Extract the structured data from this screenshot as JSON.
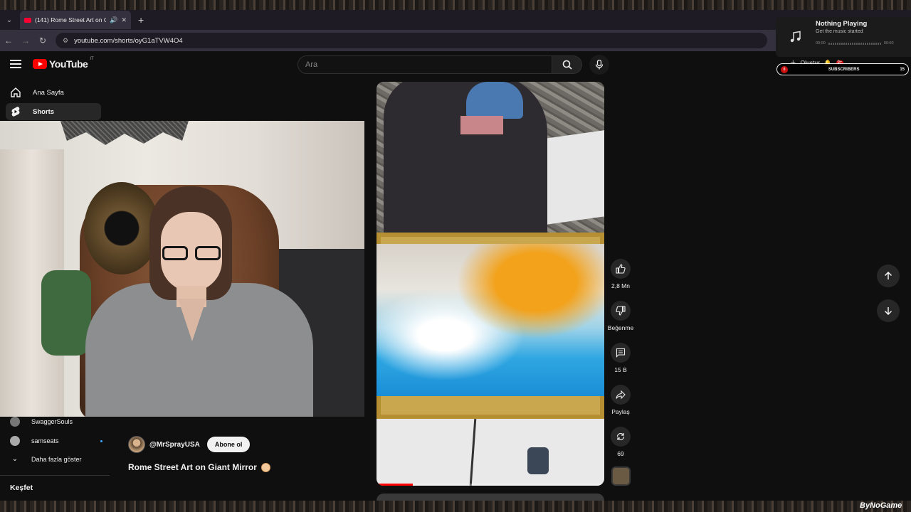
{
  "browser": {
    "tab_title": "(141) Rome Street Art on G",
    "url": "youtube.com/shorts/oyG1aTVW4O4",
    "new_tab": "+"
  },
  "youtube": {
    "logo": "YouTube",
    "region": "IT",
    "search_placeholder": "Ara",
    "create_label": "Oluştur",
    "notification_badge": "9+",
    "sidebar": {
      "items": [
        {
          "label": "Ana Sayfa",
          "icon": "home-icon"
        },
        {
          "label": "Shorts",
          "icon": "shorts-icon",
          "active": true
        }
      ],
      "subscriptions": [
        {
          "label": "SwaggerSouls"
        },
        {
          "label": "samseats",
          "new": true
        }
      ],
      "show_more": "Daha fazla göster",
      "explore_title": "Keşfet"
    },
    "short": {
      "channel": "@MrSprayUSA",
      "subscribe": "Abone ol",
      "title": "Rome Street Art on Giant Mirror",
      "progress": 0.16,
      "actions": {
        "like": "2,8 Mn",
        "dislike": "Beğenme",
        "comments": "15 B",
        "share": "Paylaş",
        "remix": "69"
      }
    }
  },
  "overlay": {
    "music": {
      "title": "Nothing Playing",
      "subtitle": "Get the music started",
      "time_start": "00:00",
      "time_end": "00:00"
    },
    "subs_widget": {
      "left": "0",
      "label": "SUBSCRIBERS",
      "right": "15"
    },
    "watermark": "ByNoGame"
  },
  "colors": {
    "background": "#0f0f0f",
    "accent": "#ff0000",
    "surface": "#272727"
  }
}
